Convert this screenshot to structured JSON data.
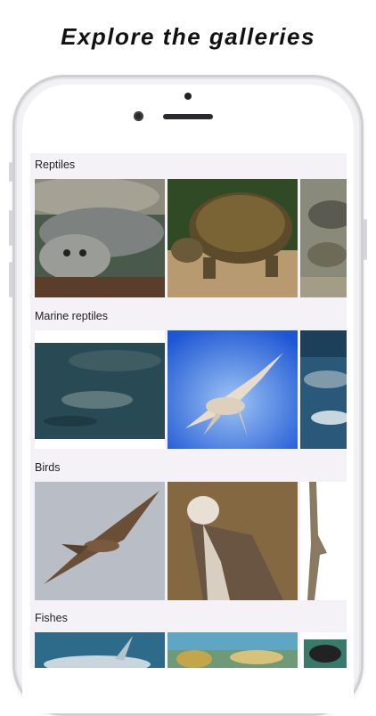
{
  "headline": "Explore the galleries",
  "sections": [
    {
      "label": "Reptiles",
      "items": [
        "softshell-turtle-photo",
        "tortoise-photo",
        "reptile-photo-partial"
      ]
    },
    {
      "label": "Marine reptiles",
      "items": [
        "ichthyosaur-swimming-photo",
        "plesiosaur-illustration",
        "marine-reptile-partial"
      ]
    },
    {
      "label": "Birds",
      "items": [
        "kite-flying-photo",
        "hawk-perched-photo",
        "bird-on-branch-partial"
      ]
    },
    {
      "label": "Fishes",
      "items": [
        "shark-photo",
        "coral-reef-photo",
        "fish-partial"
      ]
    }
  ]
}
